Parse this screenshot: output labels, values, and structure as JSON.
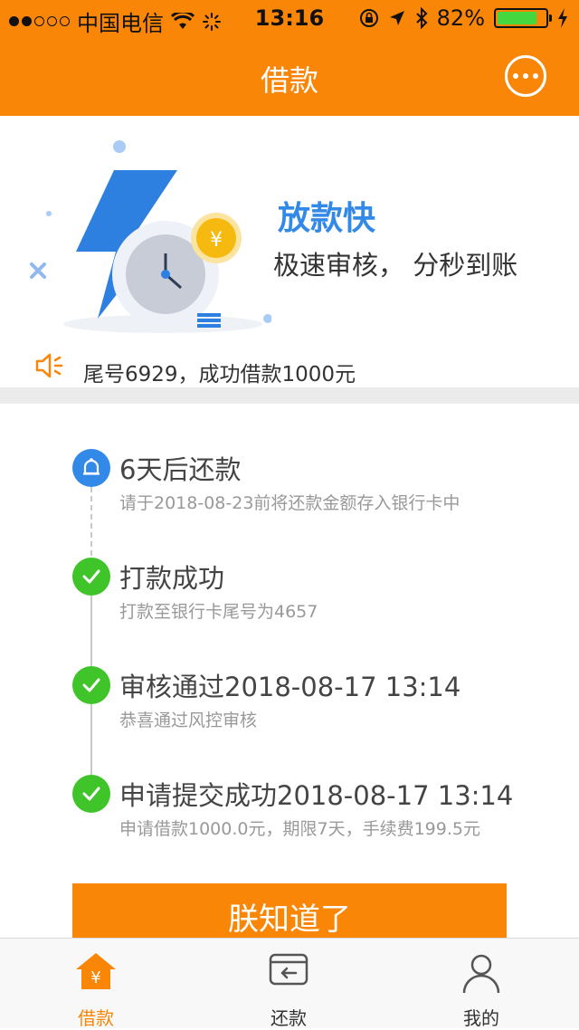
{
  "status_bar": {
    "carrier": "中国电信",
    "time": "13:16",
    "battery": "82%",
    "battery_level": 0.82
  },
  "nav": {
    "title": "借款",
    "more_icon": "more-icon"
  },
  "banner": {
    "title": "放款快",
    "subtitle": "极速审核， 分秒到账",
    "coin_symbol": "¥",
    "notice_text": "尾号6929，成功借款1000元"
  },
  "timeline": {
    "steps": [
      {
        "title": "6天后还款",
        "subtitle": "请于2018-08-23前将还款金额存入银行卡中",
        "icon": "bell-icon",
        "color": "#3389e8"
      },
      {
        "title": "打款成功",
        "subtitle": "打款至银行卡尾号为4657",
        "icon": "check-icon",
        "color": "#3fc529"
      },
      {
        "title": "审核通过2018-08-17 13:14",
        "subtitle": "恭喜通过风控审核",
        "icon": "check-icon",
        "color": "#3fc529"
      },
      {
        "title": "申请提交成功2018-08-17 13:14",
        "subtitle": "申请借款1000.0元，期限7天，手续费199.5元",
        "icon": "check-icon",
        "color": "#3fc529"
      }
    ]
  },
  "cta": {
    "label": "朕知道了"
  },
  "tabbar": {
    "items": [
      {
        "label": "借款",
        "icon": "loan-house-icon",
        "active": true
      },
      {
        "label": "还款",
        "icon": "repay-card-icon",
        "active": false
      },
      {
        "label": "我的",
        "icon": "user-icon",
        "active": false
      }
    ]
  },
  "colors": {
    "brand": "#f98607",
    "accent_blue": "#3389e8",
    "success_green": "#3fc529"
  }
}
